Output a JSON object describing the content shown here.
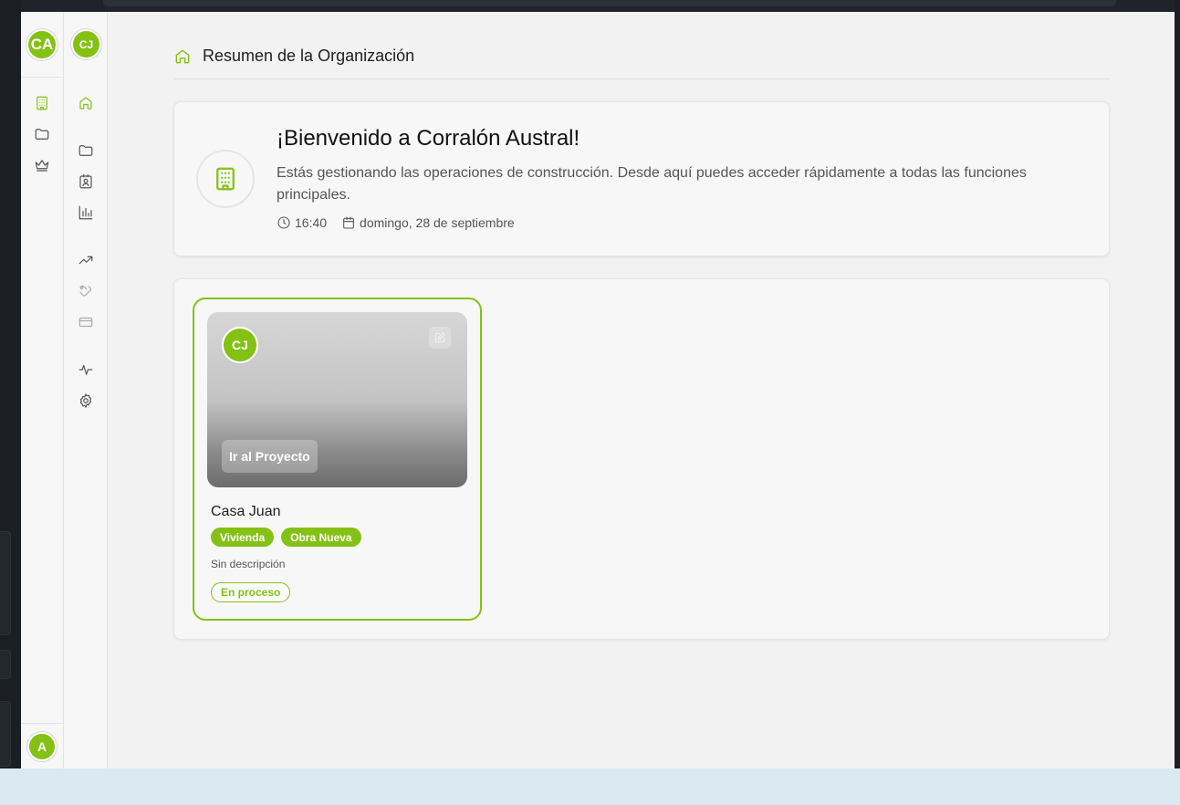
{
  "org": {
    "initials": "CA"
  },
  "project_switcher": {
    "initials": "CJ"
  },
  "user": {
    "initials": "A"
  },
  "rail_left": {
    "items": [
      "building-icon",
      "folder-icon",
      "crown-icon"
    ]
  },
  "rail_right": {
    "items": [
      "home-icon",
      "folder-icon",
      "contact-icon",
      "bar-chart-icon",
      "trending-up-icon",
      "handshake-icon",
      "credit-card-icon",
      "activity-icon",
      "gear-icon"
    ]
  },
  "header": {
    "title": "Resumen de la Organización"
  },
  "welcome": {
    "title": "¡Bienvenido a Corralón Austral!",
    "description": "Estás gestionando las operaciones de construcción. Desde aquí puedes acceder rápidamente a todas las funciones principales.",
    "time": "16:40",
    "date": "domingo, 28 de septiembre"
  },
  "project": {
    "initials": "CJ",
    "go_label": "Ir al Proyecto",
    "name": "Casa Juan",
    "tags": [
      "Vivienda",
      "Obra Nueva"
    ],
    "description": "Sin descripción",
    "status": "En proceso"
  },
  "colors": {
    "accent": "#84c115"
  }
}
